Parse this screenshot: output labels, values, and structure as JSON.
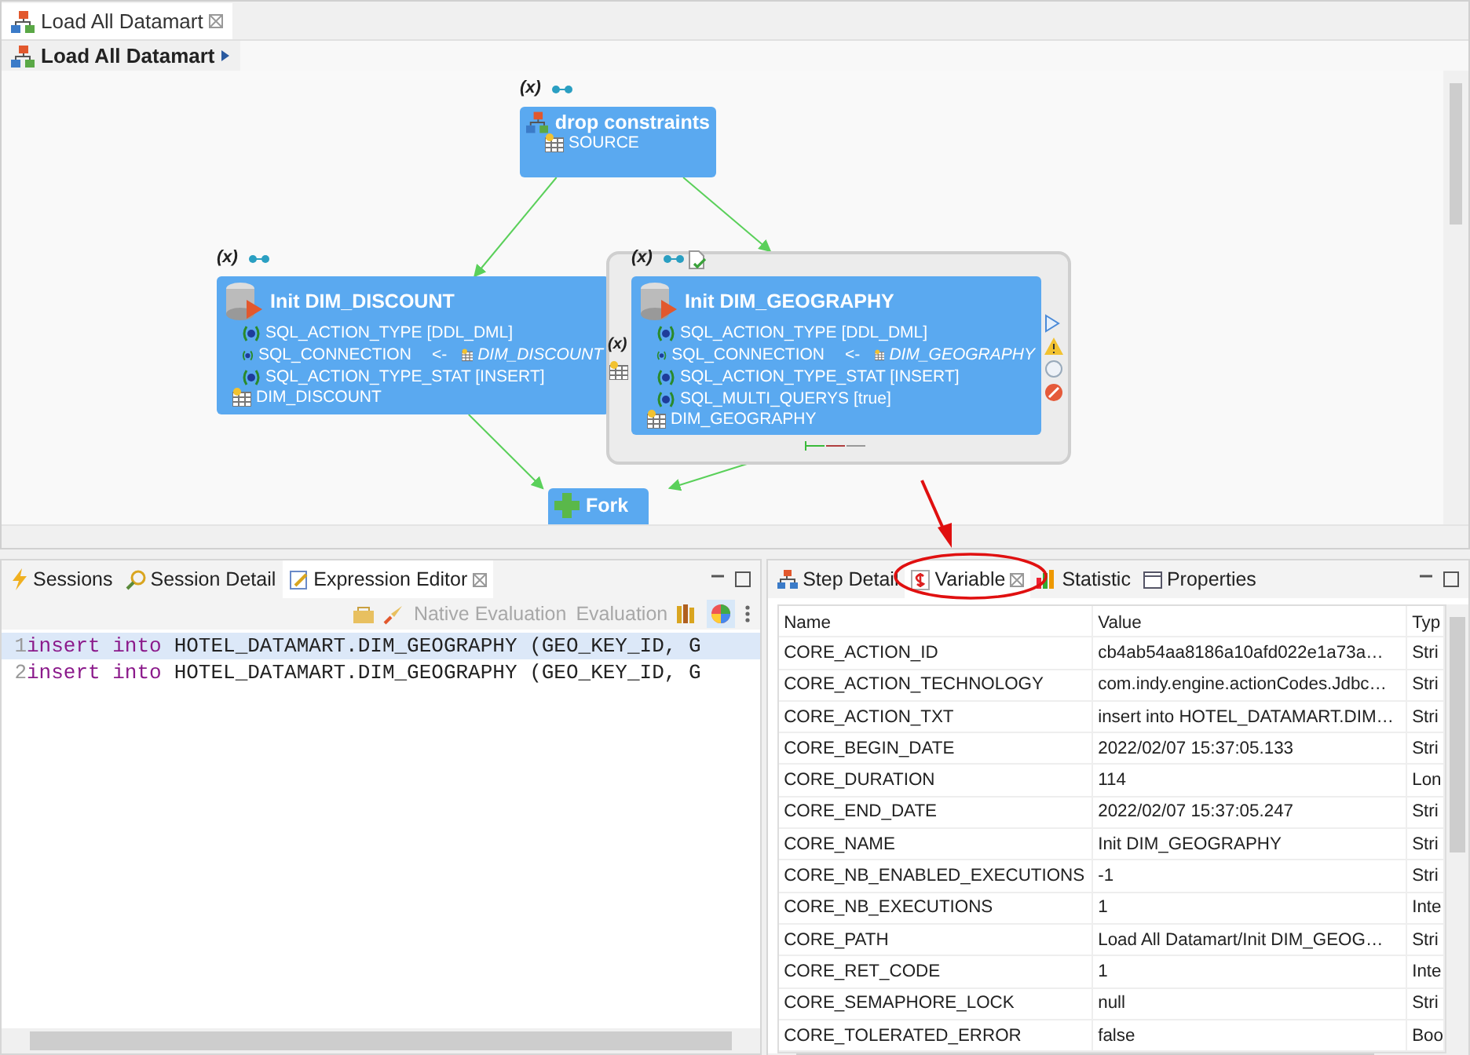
{
  "editor": {
    "tab": {
      "label": "Load All Datamart",
      "selected": true
    },
    "breadcrumb": "Load All Datamart"
  },
  "diagram": {
    "nodes": [
      {
        "kind": "process",
        "badge": "(x)",
        "title": "drop constraints",
        "footer": "SOURCE",
        "selected": false
      },
      {
        "kind": "action",
        "badge": "(x)",
        "title": "Init DIM_DISCOUNT",
        "params": [
          {
            "text": "SQL_ACTION_TYPE [DDL_DML]"
          },
          {
            "text": "SQL_CONNECTION",
            "arrow": "<-",
            "link": "DIM_DISCOUNT"
          },
          {
            "text": "SQL_ACTION_TYPE_STAT [INSERT]"
          }
        ],
        "footer": "DIM_DISCOUNT",
        "selected": false
      },
      {
        "kind": "action",
        "badge": "(x)",
        "side_badge": "(x)",
        "title": "Init DIM_GEOGRAPHY",
        "params": [
          {
            "text": "SQL_ACTION_TYPE [DDL_DML]"
          },
          {
            "text": "SQL_CONNECTION",
            "arrow": "<-",
            "link": "DIM_GEOGRAPHY"
          },
          {
            "text": "SQL_ACTION_TYPE_STAT [INSERT]"
          },
          {
            "text": "SQL_MULTI_QUERYS [true]"
          }
        ],
        "footer": "DIM_GEOGRAPHY",
        "selected": true
      },
      {
        "kind": "fork",
        "title": "Fork",
        "selected": false
      }
    ]
  },
  "left_panel": {
    "tabs": [
      {
        "label": "Sessions",
        "selected": false
      },
      {
        "label": "Session Detail",
        "selected": false
      },
      {
        "label": "Expression Editor",
        "selected": true
      }
    ],
    "toolbar": [
      "Native Evaluation",
      "Evaluation"
    ],
    "code_lines": [
      {
        "number": "1",
        "keyword": "insert into",
        "text": "HOTEL_DATAMART.DIM_GEOGRAPHY (GEO_KEY_ID, G",
        "selected": true
      },
      {
        "number": "2",
        "keyword": "insert into",
        "text": "HOTEL_DATAMART.DIM_GEOGRAPHY (GEO_KEY_ID, G",
        "selected": false
      }
    ]
  },
  "right_panel": {
    "tabs": [
      {
        "label": "Step Detail",
        "selected": false
      },
      {
        "label": "Variable",
        "selected": true
      },
      {
        "label": "Statistic",
        "selected": false
      },
      {
        "label": "Properties",
        "selected": false
      }
    ],
    "table": {
      "columns": [
        "Name",
        "Value",
        "Typ"
      ],
      "rows": [
        [
          "CORE_ACTION_ID",
          "cb4ab54aa8186a10afd022e1a73a…",
          "Stri"
        ],
        [
          "CORE_ACTION_TECHNOLOGY",
          "com.indy.engine.actionCodes.Jdbc…",
          "Stri"
        ],
        [
          "CORE_ACTION_TXT",
          "insert into HOTEL_DATAMART.DIM…",
          "Stri"
        ],
        [
          "CORE_BEGIN_DATE",
          "2022/02/07 15:37:05.133",
          "Stri"
        ],
        [
          "CORE_DURATION",
          "114",
          "Lon"
        ],
        [
          "CORE_END_DATE",
          "2022/02/07 15:37:05.247",
          "Stri"
        ],
        [
          "CORE_NAME",
          "Init DIM_GEOGRAPHY",
          "Stri"
        ],
        [
          "CORE_NB_ENABLED_EXECUTIONS",
          "-1",
          "Stri"
        ],
        [
          "CORE_NB_EXECUTIONS",
          "1",
          "Inte"
        ],
        [
          "CORE_PATH",
          "Load All Datamart/Init DIM_GEOG…",
          "Stri"
        ],
        [
          "CORE_RET_CODE",
          "1",
          "Inte"
        ],
        [
          "CORE_SEMAPHORE_LOCK",
          "null",
          "Stri"
        ],
        [
          "CORE_TOLERATED_ERROR",
          "false",
          "Boo"
        ]
      ]
    }
  }
}
